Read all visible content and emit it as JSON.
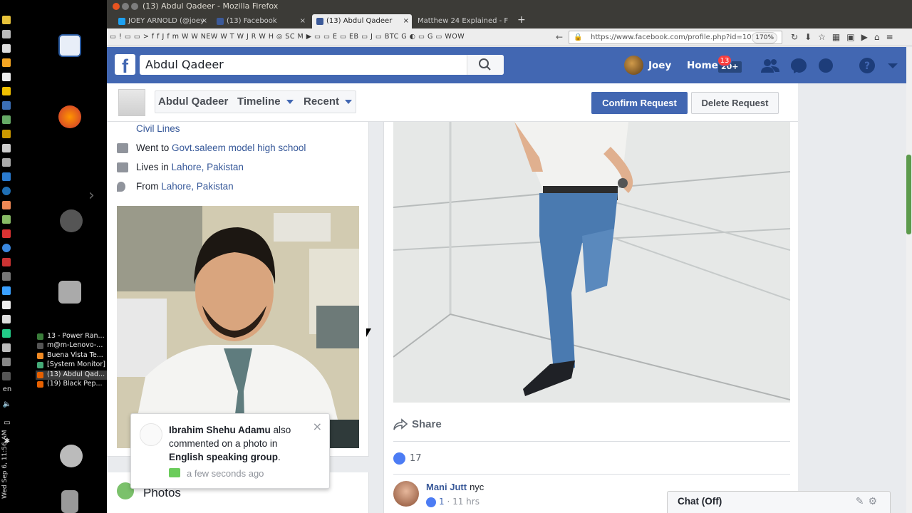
{
  "window": {
    "title": "(13) Abdul Qadeer - Mozilla Firefox"
  },
  "tabs": [
    {
      "label": "JOEY ARNOLD (@joey",
      "active": false
    },
    {
      "label": "(13) Facebook",
      "active": false
    },
    {
      "label": "(13) Abdul Qadeer",
      "active": true
    },
    {
      "label": "Matthew 24 Explained - F",
      "active": false
    }
  ],
  "bookmarks_text": "▭ ! ▭ ▭ > f f J f m W W NEW W T W J R W H ◎ SC M ▶ ▭ ▭ E ▭ EB ▭ J ▭ BTC G ◐ ▭ G ▭ WOW",
  "urlbar": {
    "url": "https://www.facebook.com/profile.php?id=1000",
    "zoom": "170%"
  },
  "taskbar": {
    "windows": [
      {
        "label": "13 - Power Ran...",
        "color": "#3a7d3a",
        "active": false
      },
      {
        "label": "m@m-Lenovo-...",
        "color": "#555",
        "active": false
      },
      {
        "label": "Buena Vista Te...",
        "color": "#f08a24",
        "active": false
      },
      {
        "label": "[System Monitor]",
        "color": "#4a7",
        "active": false
      },
      {
        "label": "(13) Abdul Qad...",
        "color": "#e66000",
        "active": true
      },
      {
        "label": "(19) Black Pep...",
        "color": "#e66000",
        "active": false
      }
    ],
    "lang": "en",
    "clock": "Wed Sep 6, 11:56 AM"
  },
  "header": {
    "logo": "f",
    "search_value": "Abdul Qadeer",
    "user_name": "Joey",
    "home_label": "Home",
    "home_badge": "20+",
    "notifications_count": "13"
  },
  "profile_nav": {
    "name": "Abdul Qadeer",
    "timeline": "Timeline",
    "recent": "Recent",
    "confirm": "Confirm Request",
    "delete": "Delete Request"
  },
  "intro": {
    "location_top": "Civil Lines",
    "went_prefix": "Went to",
    "school": "Govt.saleem model high school",
    "lives_prefix": "Lives in",
    "lives": "Lahore, Pakistan",
    "from_prefix": "From",
    "from": "Lahore, Pakistan"
  },
  "photos_label": "Photos",
  "post": {
    "share_label": "Share",
    "likes": "17",
    "comment": {
      "author": "Mani Jutt",
      "text": "nyc",
      "likes": "1",
      "time": "11 hrs"
    }
  },
  "toast": {
    "actor": "Ibrahim Shehu Adamu",
    "middle": "also commented on a photo in",
    "group": "English speaking group",
    "time": "a few seconds ago"
  },
  "chat": {
    "label": "Chat (Off)"
  },
  "colors": {
    "brand": "#4267b2",
    "link": "#365899",
    "badge": "#fa3e3e"
  }
}
